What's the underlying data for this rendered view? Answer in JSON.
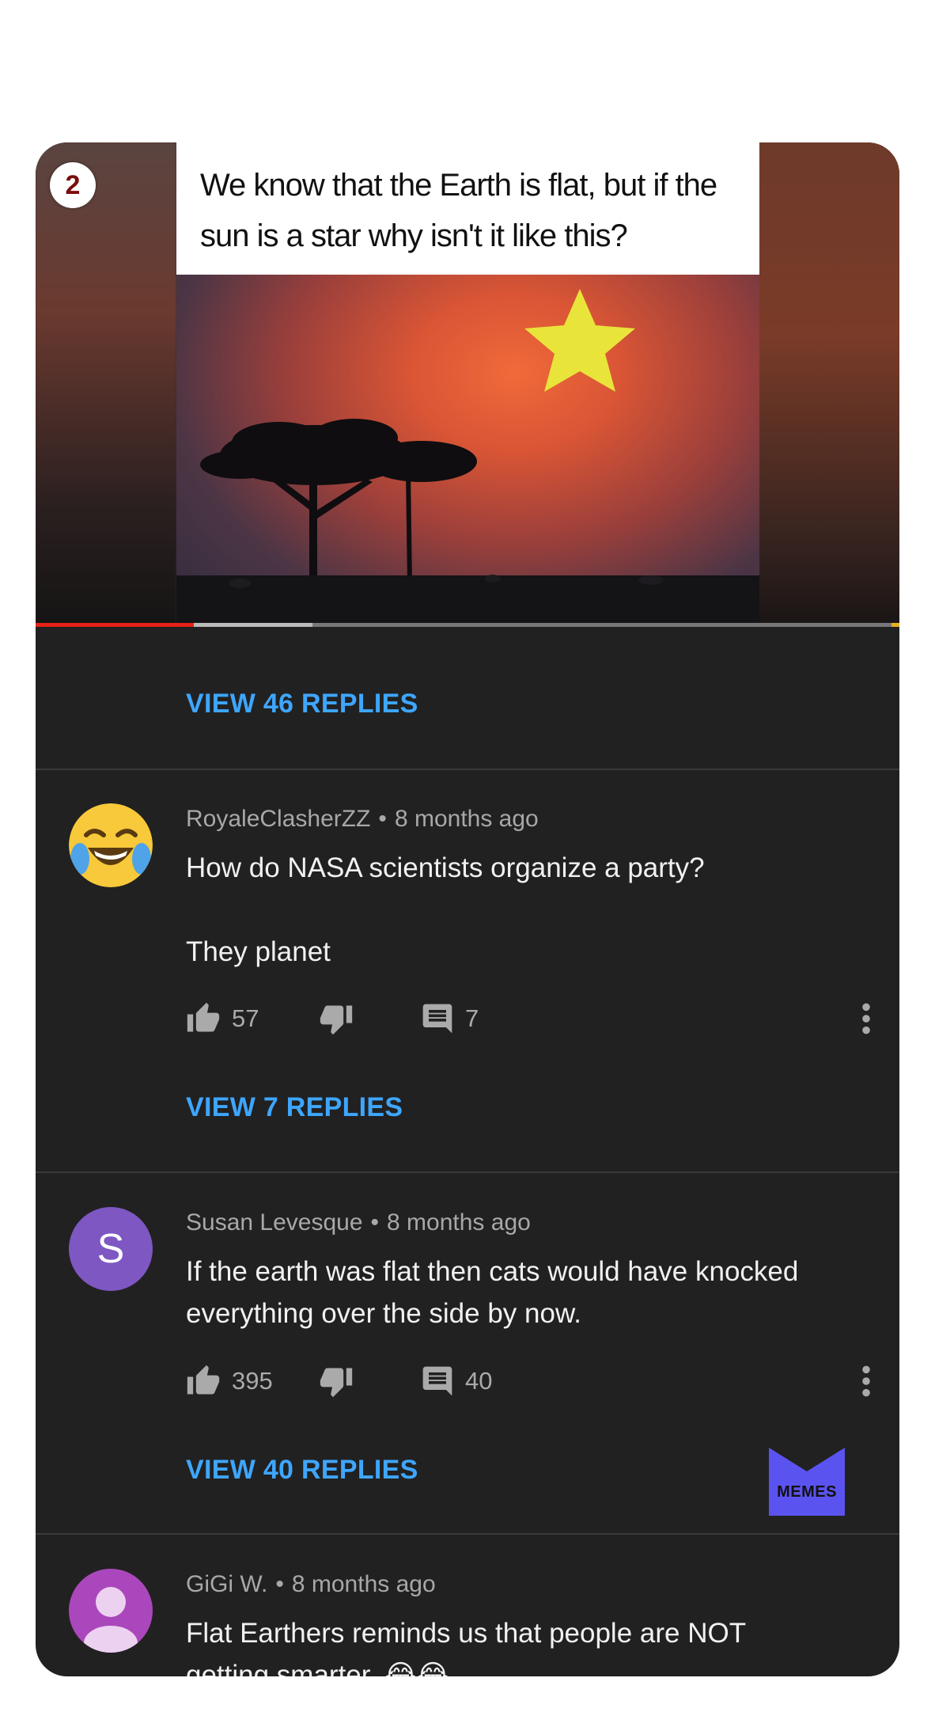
{
  "video": {
    "badge_number": "2",
    "caption_line1": "We know that the Earth is flat, but if the",
    "caption_line2": "sun is a star why isn't it like this?"
  },
  "comments": [
    {
      "view_replies_label": "VIEW 46 REPLIES"
    },
    {
      "author": "RoyaleClasherZZ",
      "time": "8 months ago",
      "avatar_icon": "laughing-emoji-icon",
      "text_line1": "How do NASA scientists organize a party?",
      "text_line2": "They planet",
      "likes": "57",
      "replies": "7",
      "view_replies_label": "VIEW 7 REPLIES"
    },
    {
      "author": "Susan Levesque",
      "time": "8 months ago",
      "avatar_letter": "S",
      "avatar_color": "#7e57c2",
      "text_line1": "If the earth was flat then cats would have knocked",
      "text_line2": "everything over the side by now.",
      "likes": "395",
      "replies": "40",
      "view_replies_label": "VIEW 40 REPLIES"
    },
    {
      "author": "GiGi W.",
      "time": "8 months ago",
      "avatar_color": "#ab47bc",
      "text_line1": "Flat Earthers reminds us that people are NOT",
      "text_line2": "getting smarter. 😂😂"
    }
  ],
  "separator": "•",
  "watermark": "MEMES",
  "colors": {
    "link_blue": "#3ea6ff",
    "background_dark": "#212121",
    "progress_red": "#e62117"
  }
}
